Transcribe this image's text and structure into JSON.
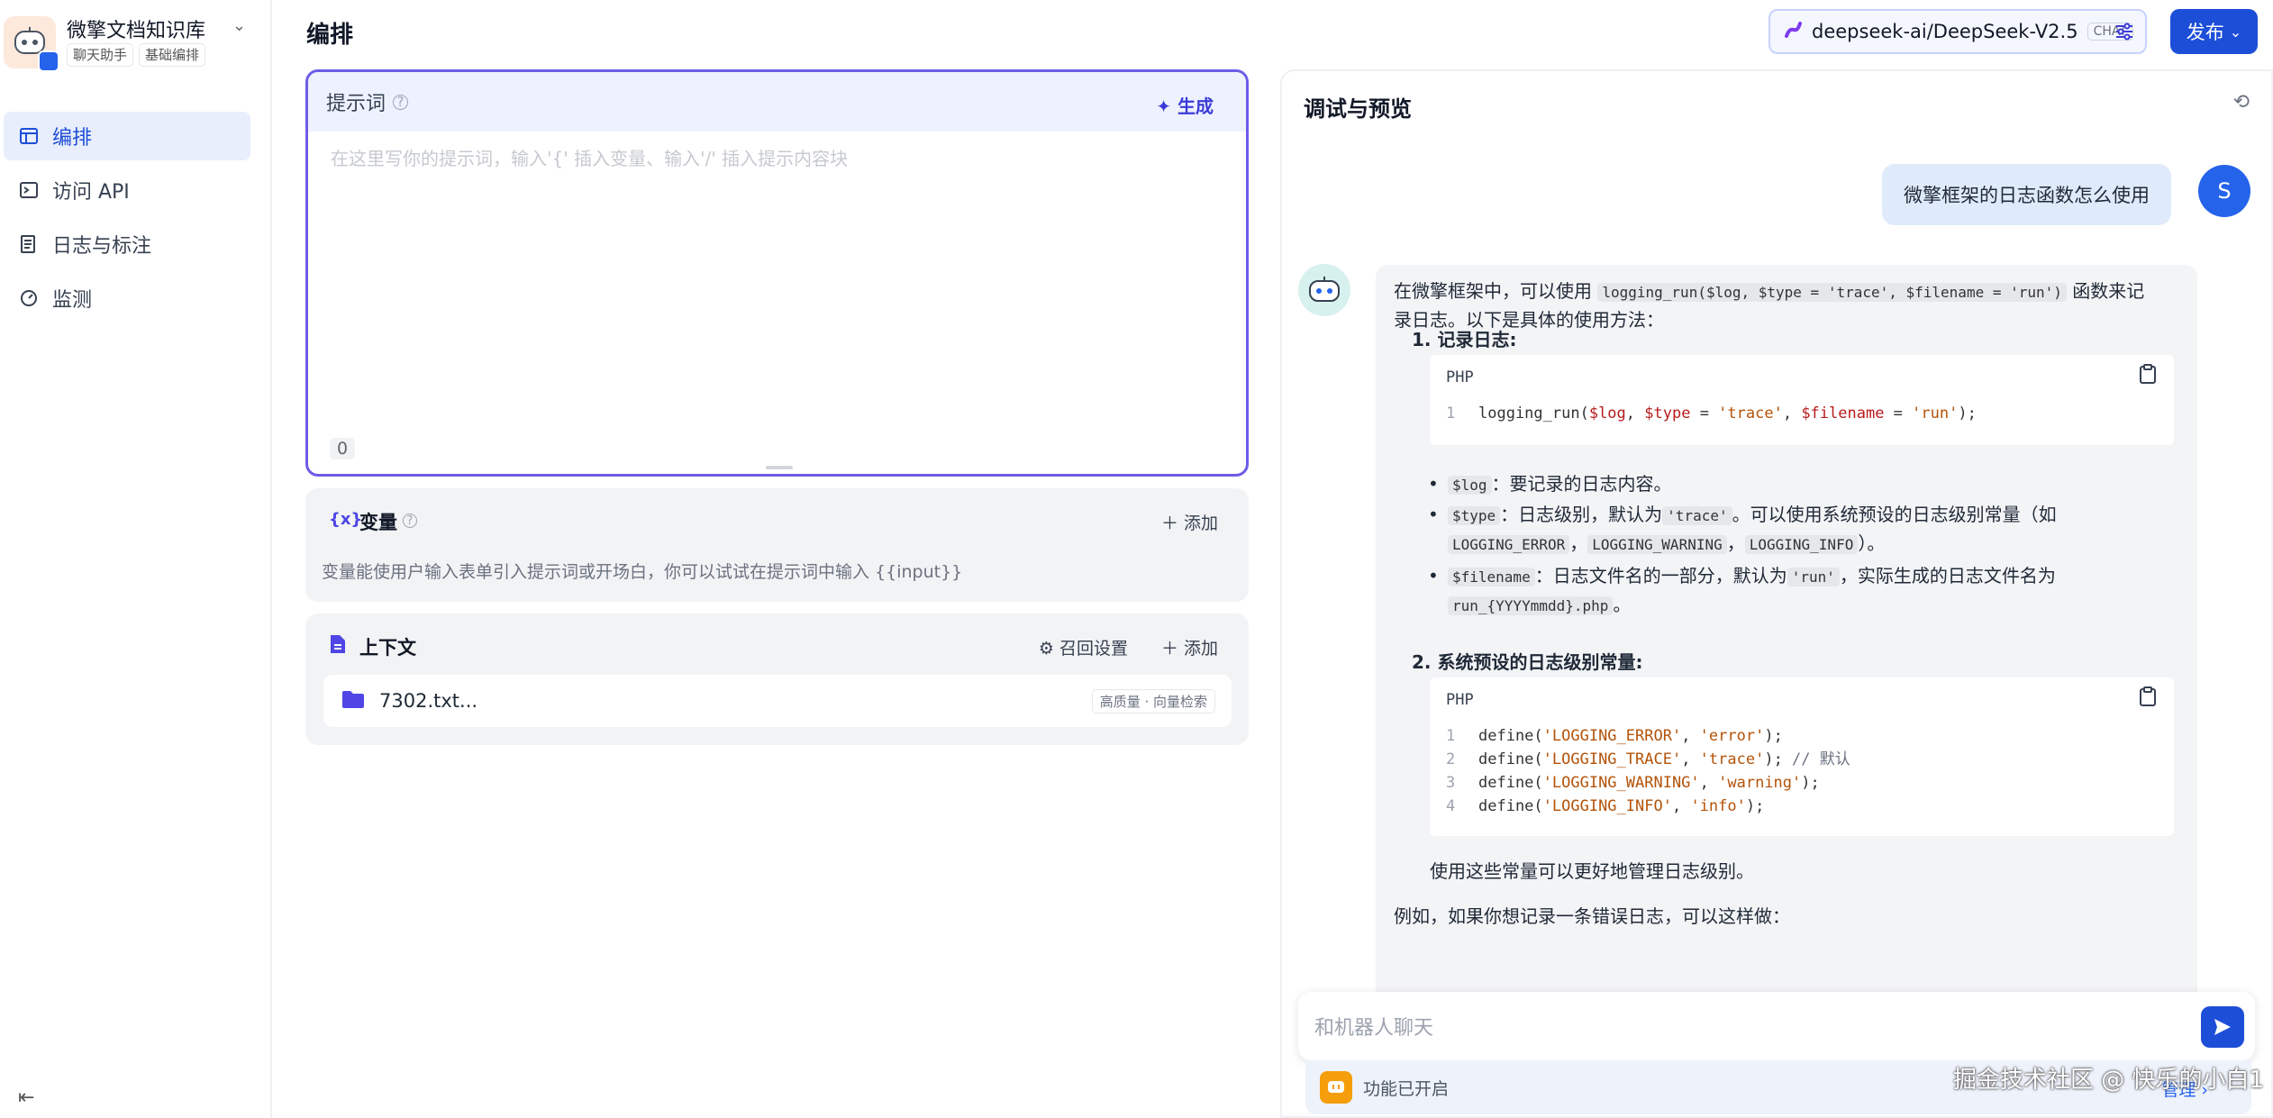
{
  "app": {
    "name": "微擎文档知识库",
    "tags": [
      "聊天助手",
      "基础编排"
    ]
  },
  "nav": [
    {
      "label": "编排",
      "icon": "layout-icon",
      "active": true
    },
    {
      "label": "访问 API",
      "icon": "terminal-icon"
    },
    {
      "label": "日志与标注",
      "icon": "document-icon"
    },
    {
      "label": "监测",
      "icon": "gauge-icon"
    }
  ],
  "header": {
    "title": "编排",
    "model": "deepseek-ai/DeepSeek-V2.5",
    "model_badge": "CHAT",
    "publish": "发布"
  },
  "prompt": {
    "title": "提示词",
    "generate": "生成",
    "placeholder": "在这里写你的提示词，输入'{' 插入变量、输入'/' 插入提示内容块",
    "count": "0"
  },
  "variables": {
    "icon_text": "{x}",
    "title": "变量",
    "add": "添加",
    "description": "变量能使用户输入表单引入提示词或开场白，你可以试试在提示词中输入 {{input}}"
  },
  "context": {
    "title": "上下文",
    "recall": "召回设置",
    "add": "添加",
    "file": "7302.txt...",
    "file_tag": "高质量 · 向量检索"
  },
  "debug": {
    "title": "调试与预览",
    "user_avatar": "S",
    "user_message": "微擎框架的日志函数怎么使用",
    "bot": {
      "intro_a": "在微擎框架中，可以使用",
      "intro_code": "logging_run($log, $type = 'trace', $filename = 'run')",
      "intro_b": "函数来记",
      "intro_c": "录日志。以下是具体的使用方法：",
      "h1": "记录日志",
      "h2": "系统预设的日志级别常量",
      "lang": "PHP",
      "code1": {
        "fn": "logging_run(",
        "a": "$log",
        "sep1": ", ",
        "b": "$type",
        "eq1": " = ",
        "c": "'trace'",
        "sep2": ", ",
        "d": "$filename",
        "eq2": " = ",
        "e": "'run'",
        "end": ");"
      },
      "b1_code": "$log",
      "b1_text": "：要记录的日志内容。",
      "b2_code": "$type",
      "b2_text": "：日志级别，默认为",
      "b2_code2": "'trace'",
      "b2_text2": "。可以使用系统预设的日志级别常量（如",
      "b2_c3": "LOGGING_ERROR",
      "b2_c4": "LOGGING_WARNING",
      "b2_c5": "LOGGING_INFO",
      "comma": "，",
      "b2_end": "）。",
      "b3_code": "$filename",
      "b3_text": "：日志文件名的一部分，默认为",
      "b3_code2": "'run'",
      "b3_text2": "，实际生成的日志文件名为",
      "b3_code3": "run_{YYYYmmdd}.php",
      "b3_end": "。",
      "code2": [
        {
          "k": "'LOGGING_ERROR'",
          "v": "'error'",
          "c": ""
        },
        {
          "k": "'LOGGING_TRACE'",
          "v": "'trace'",
          "c": " // 默认"
        },
        {
          "k": "'LOGGING_WARNING'",
          "v": "'warning'",
          "c": ""
        },
        {
          "k": "'LOGGING_INFO'",
          "v": "'info'",
          "c": ""
        }
      ],
      "define": "define(",
      "p1": "使用这些常量可以更好地管理日志级别。",
      "p2": "例如，如果你想记录一条错误日志，可以这样做："
    },
    "input_placeholder": "和机器人聊天",
    "feature": "功能已开启",
    "manage": "管理 ›"
  },
  "watermark": "掘金技术社区 @ 快乐的小白1"
}
